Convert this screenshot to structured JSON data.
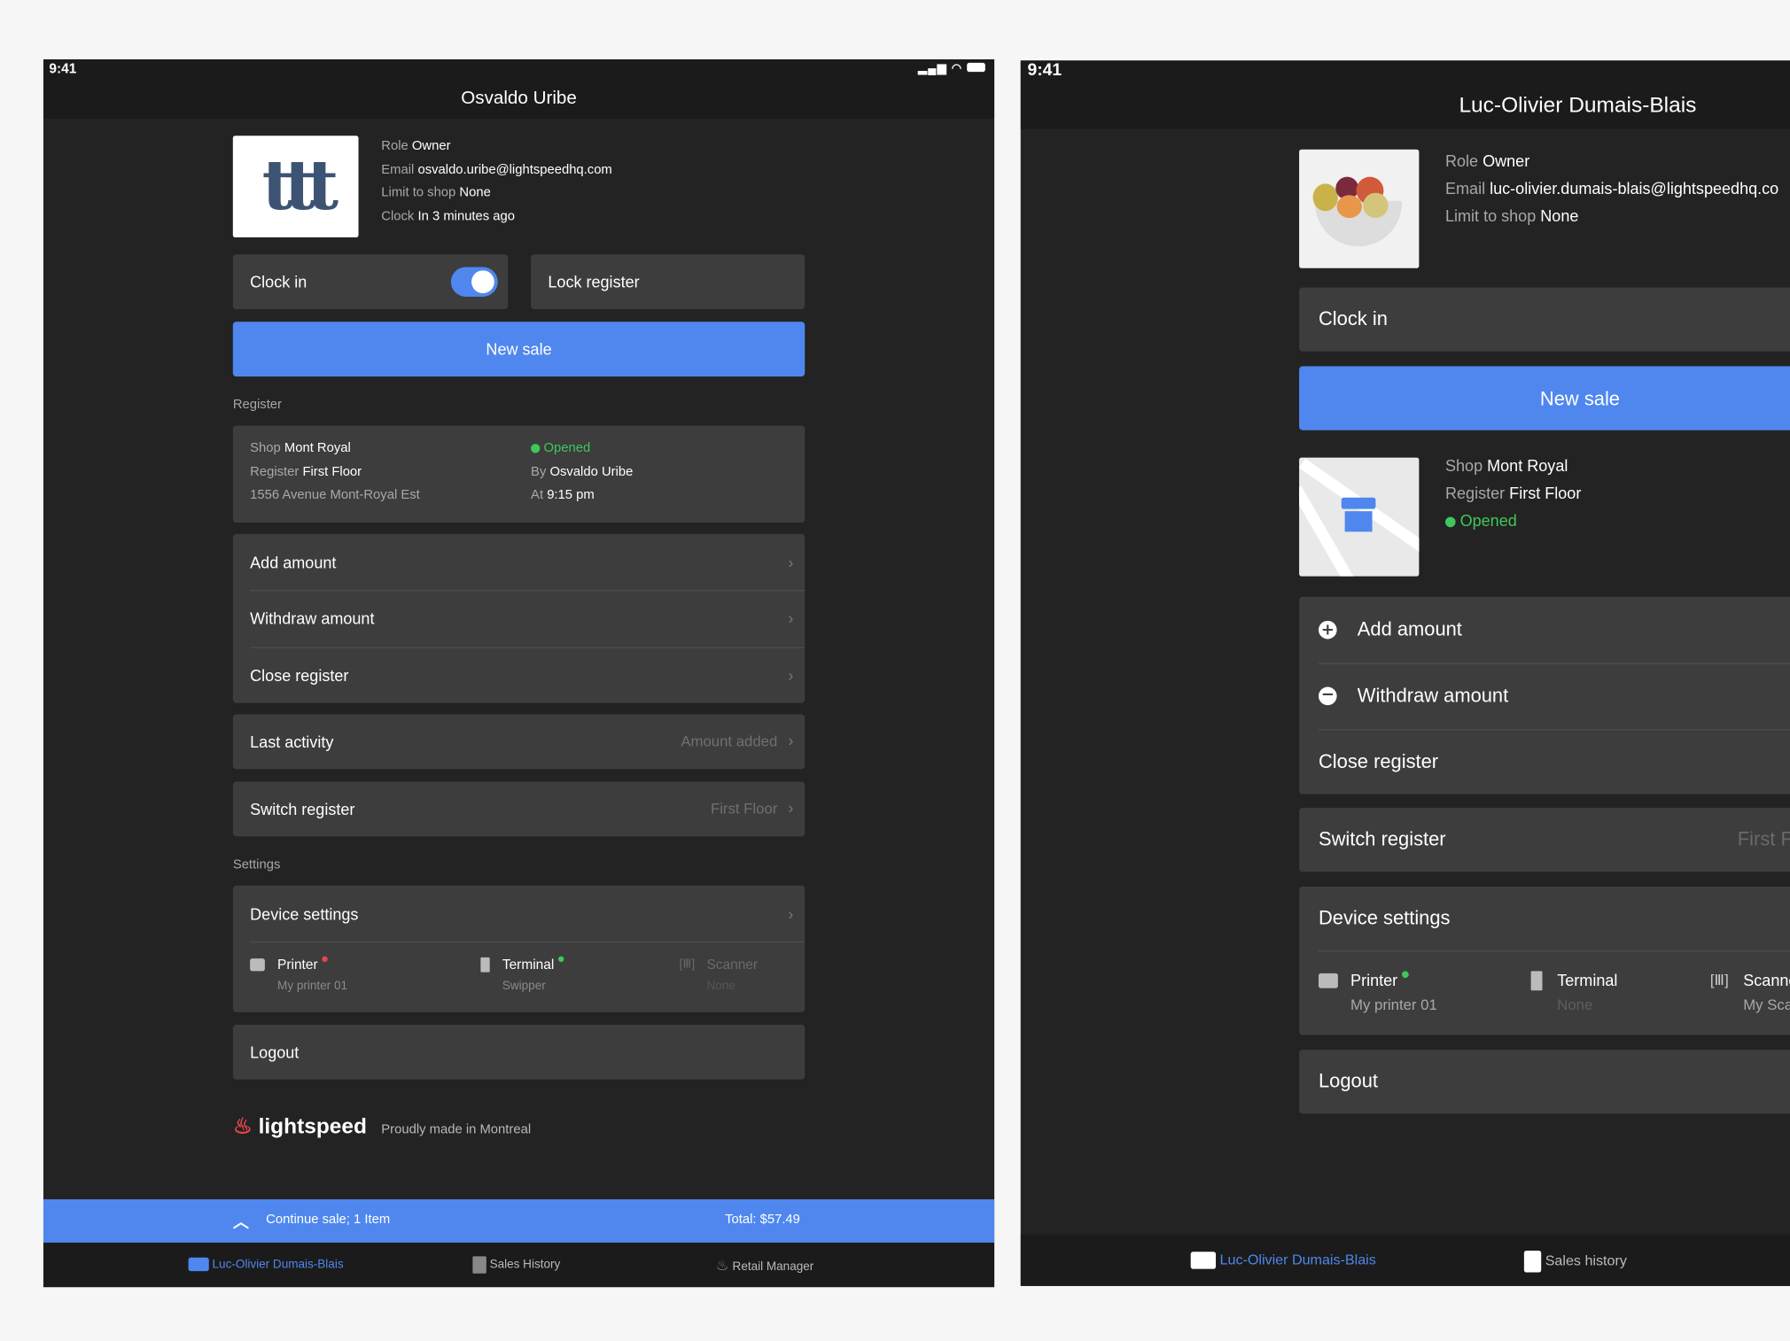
{
  "left": {
    "status_time": "9:41",
    "title": "Osvaldo Uribe",
    "profile": {
      "role_label": "Role",
      "role": "Owner",
      "email_label": "Email",
      "email": "osvaldo.uribe@lightspeedhq.com",
      "limit_label": "Limit to shop",
      "limit": "None",
      "clock_label": "Clock",
      "clock_state": "In",
      "clock_time": "3 minutes ago"
    },
    "clock_in": {
      "label": "Clock in",
      "on": true
    },
    "lock_register": "Lock register",
    "new_sale": "New sale",
    "register_section": "Register",
    "register": {
      "shop_label": "Shop",
      "shop": "Mont Royal",
      "register_label": "Register",
      "register": "First Floor",
      "address": "1556 Avenue Mont-Royal Est",
      "status": "Opened",
      "by_label": "By",
      "by": "Osvaldo Uribe",
      "at_label": "At",
      "at": "9:15 pm"
    },
    "actions": [
      "Add amount",
      "Withdraw amount",
      "Close register"
    ],
    "last_activity": {
      "label": "Last activity",
      "value": "Amount added"
    },
    "switch_register": {
      "label": "Switch register",
      "value": "First Floor"
    },
    "settings_section": "Settings",
    "device_settings": "Device settings",
    "devices": [
      {
        "name": "Printer",
        "sub": "My printer 01",
        "status": "red"
      },
      {
        "name": "Terminal",
        "sub": "Swipper",
        "status": "green"
      },
      {
        "name": "Scanner",
        "sub": "None",
        "status": "none"
      }
    ],
    "logout": "Logout",
    "brand": "lightspeed",
    "tagline": "Proudly made in Montreal",
    "continue_sale": "Continue sale; 1 Item",
    "total": "Total: $57.49",
    "tabs": [
      "Luc-Olivier Dumais-Blais",
      "Sales History",
      "Retail Manager"
    ]
  },
  "right": {
    "status_time": "9:41",
    "title": "Luc-Olivier Dumais-Blais",
    "profile": {
      "role_label": "Role",
      "role": "Owner",
      "email_label": "Email",
      "email": "luc-olivier.dumais-blais@lightspeedhq.co",
      "limit_label": "Limit to shop",
      "limit": "None"
    },
    "clock_in": "Clock in",
    "new_sale": "New sale",
    "register": {
      "shop_label": "Shop",
      "shop": "Mont Royal",
      "register_label": "Register",
      "register": "First Floor",
      "status": "Opened"
    },
    "actions": [
      "Add amount",
      "Withdraw amount",
      "Close register"
    ],
    "switch_register": {
      "label": "Switch register",
      "value": "First F"
    },
    "device_settings": "Device settings",
    "devices": [
      {
        "name": "Printer",
        "sub": "My printer 01",
        "status": "green"
      },
      {
        "name": "Terminal",
        "sub": "None"
      },
      {
        "name": "Scanne",
        "sub": "My Sca"
      }
    ],
    "logout": "Logout",
    "tabs": [
      "Luc-Olivier Dumais-Blais",
      "Sales history"
    ]
  },
  "colors": {
    "accent": "#4f87ee",
    "opened": "#3fc75a",
    "alert": "#e2474b",
    "card": "#3c3d3c",
    "background": "#232323"
  }
}
